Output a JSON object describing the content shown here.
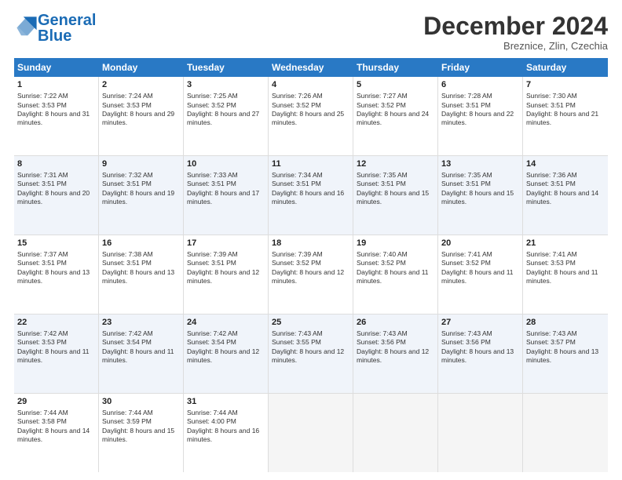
{
  "logo": {
    "part1": "General",
    "part2": "Blue"
  },
  "title": "December 2024",
  "location": "Breznice, Zlin, Czechia",
  "days": [
    "Sunday",
    "Monday",
    "Tuesday",
    "Wednesday",
    "Thursday",
    "Friday",
    "Saturday"
  ],
  "weeks": [
    [
      {
        "num": "1",
        "sunrise": "7:22 AM",
        "sunset": "3:53 PM",
        "daylight": "8 hours and 31 minutes."
      },
      {
        "num": "2",
        "sunrise": "7:24 AM",
        "sunset": "3:53 PM",
        "daylight": "8 hours and 29 minutes."
      },
      {
        "num": "3",
        "sunrise": "7:25 AM",
        "sunset": "3:52 PM",
        "daylight": "8 hours and 27 minutes."
      },
      {
        "num": "4",
        "sunrise": "7:26 AM",
        "sunset": "3:52 PM",
        "daylight": "8 hours and 25 minutes."
      },
      {
        "num": "5",
        "sunrise": "7:27 AM",
        "sunset": "3:52 PM",
        "daylight": "8 hours and 24 minutes."
      },
      {
        "num": "6",
        "sunrise": "7:28 AM",
        "sunset": "3:51 PM",
        "daylight": "8 hours and 22 minutes."
      },
      {
        "num": "7",
        "sunrise": "7:30 AM",
        "sunset": "3:51 PM",
        "daylight": "8 hours and 21 minutes."
      }
    ],
    [
      {
        "num": "8",
        "sunrise": "7:31 AM",
        "sunset": "3:51 PM",
        "daylight": "8 hours and 20 minutes."
      },
      {
        "num": "9",
        "sunrise": "7:32 AM",
        "sunset": "3:51 PM",
        "daylight": "8 hours and 19 minutes."
      },
      {
        "num": "10",
        "sunrise": "7:33 AM",
        "sunset": "3:51 PM",
        "daylight": "8 hours and 17 minutes."
      },
      {
        "num": "11",
        "sunrise": "7:34 AM",
        "sunset": "3:51 PM",
        "daylight": "8 hours and 16 minutes."
      },
      {
        "num": "12",
        "sunrise": "7:35 AM",
        "sunset": "3:51 PM",
        "daylight": "8 hours and 15 minutes."
      },
      {
        "num": "13",
        "sunrise": "7:35 AM",
        "sunset": "3:51 PM",
        "daylight": "8 hours and 15 minutes."
      },
      {
        "num": "14",
        "sunrise": "7:36 AM",
        "sunset": "3:51 PM",
        "daylight": "8 hours and 14 minutes."
      }
    ],
    [
      {
        "num": "15",
        "sunrise": "7:37 AM",
        "sunset": "3:51 PM",
        "daylight": "8 hours and 13 minutes."
      },
      {
        "num": "16",
        "sunrise": "7:38 AM",
        "sunset": "3:51 PM",
        "daylight": "8 hours and 13 minutes."
      },
      {
        "num": "17",
        "sunrise": "7:39 AM",
        "sunset": "3:51 PM",
        "daylight": "8 hours and 12 minutes."
      },
      {
        "num": "18",
        "sunrise": "7:39 AM",
        "sunset": "3:52 PM",
        "daylight": "8 hours and 12 minutes."
      },
      {
        "num": "19",
        "sunrise": "7:40 AM",
        "sunset": "3:52 PM",
        "daylight": "8 hours and 11 minutes."
      },
      {
        "num": "20",
        "sunrise": "7:41 AM",
        "sunset": "3:52 PM",
        "daylight": "8 hours and 11 minutes."
      },
      {
        "num": "21",
        "sunrise": "7:41 AM",
        "sunset": "3:53 PM",
        "daylight": "8 hours and 11 minutes."
      }
    ],
    [
      {
        "num": "22",
        "sunrise": "7:42 AM",
        "sunset": "3:53 PM",
        "daylight": "8 hours and 11 minutes."
      },
      {
        "num": "23",
        "sunrise": "7:42 AM",
        "sunset": "3:54 PM",
        "daylight": "8 hours and 11 minutes."
      },
      {
        "num": "24",
        "sunrise": "7:42 AM",
        "sunset": "3:54 PM",
        "daylight": "8 hours and 12 minutes."
      },
      {
        "num": "25",
        "sunrise": "7:43 AM",
        "sunset": "3:55 PM",
        "daylight": "8 hours and 12 minutes."
      },
      {
        "num": "26",
        "sunrise": "7:43 AM",
        "sunset": "3:56 PM",
        "daylight": "8 hours and 12 minutes."
      },
      {
        "num": "27",
        "sunrise": "7:43 AM",
        "sunset": "3:56 PM",
        "daylight": "8 hours and 13 minutes."
      },
      {
        "num": "28",
        "sunrise": "7:43 AM",
        "sunset": "3:57 PM",
        "daylight": "8 hours and 13 minutes."
      }
    ],
    [
      {
        "num": "29",
        "sunrise": "7:44 AM",
        "sunset": "3:58 PM",
        "daylight": "8 hours and 14 minutes."
      },
      {
        "num": "30",
        "sunrise": "7:44 AM",
        "sunset": "3:59 PM",
        "daylight": "8 hours and 15 minutes."
      },
      {
        "num": "31",
        "sunrise": "7:44 AM",
        "sunset": "4:00 PM",
        "daylight": "8 hours and 16 minutes."
      },
      null,
      null,
      null,
      null
    ]
  ],
  "labels": {
    "sunrise": "Sunrise:",
    "sunset": "Sunset:",
    "daylight": "Daylight:"
  }
}
